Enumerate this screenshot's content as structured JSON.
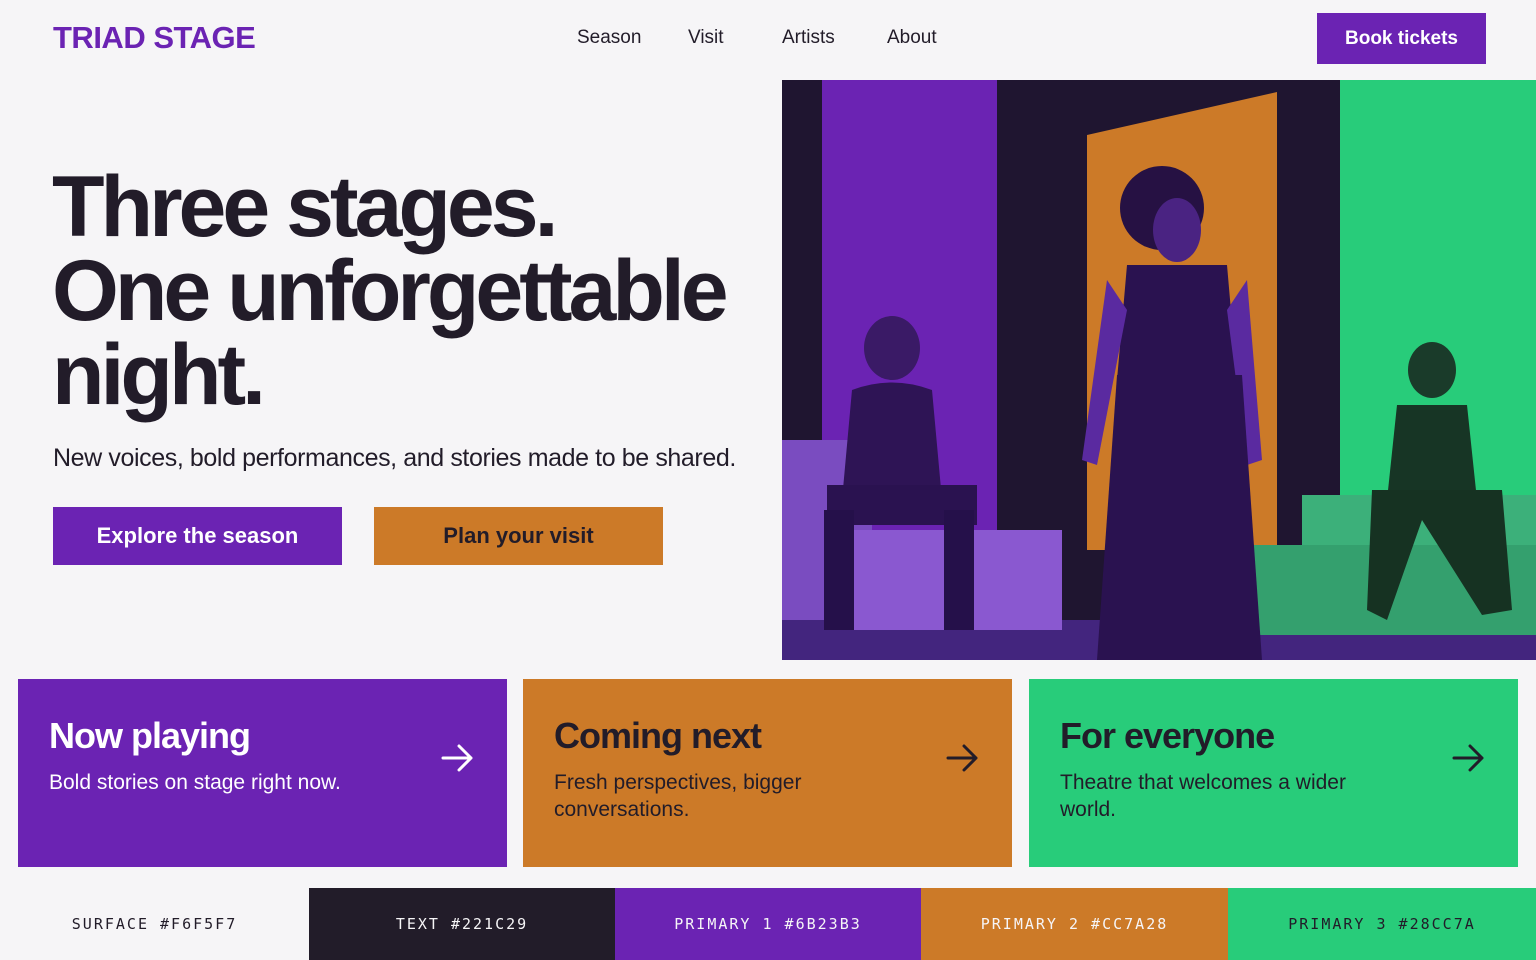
{
  "header": {
    "logo": "TRIAD STAGE",
    "nav": [
      {
        "label": "Season"
      },
      {
        "label": "Visit"
      },
      {
        "label": "Artists"
      },
      {
        "label": "About"
      }
    ],
    "book_label": "Book tickets"
  },
  "hero": {
    "headline_lines": [
      "Three stages.",
      "One unforgettable",
      "night."
    ],
    "subhead": "New voices, bold performances, and stories made to be shared.",
    "cta_primary": "Explore the season",
    "cta_secondary": "Plan your visit",
    "image": "stage-performers-photo"
  },
  "cards": [
    {
      "title": "Now playing",
      "desc": "Bold stories on stage right now.",
      "icon": "arrow-right-icon"
    },
    {
      "title": "Coming next",
      "desc": "Fresh perspectives, bigger conversations.",
      "icon": "arrow-right-icon"
    },
    {
      "title": "For everyone",
      "desc": "Theatre that welcomes a wider world.",
      "icon": "arrow-right-icon"
    }
  ],
  "palette": [
    {
      "label": "SURFACE #F6F5F7",
      "color": "#F6F5F7"
    },
    {
      "label": "TEXT #221C29",
      "color": "#221C29"
    },
    {
      "label": "PRIMARY 1 #6B23B3",
      "color": "#6B23B3"
    },
    {
      "label": "PRIMARY 2 #CC7A28",
      "color": "#CC7A28"
    },
    {
      "label": "PRIMARY 3 #28CC7A",
      "color": "#28CC7A"
    }
  ],
  "colors": {
    "surface": "#F6F5F7",
    "text": "#221C29",
    "primary1": "#6B23B3",
    "primary2": "#CC7A28",
    "primary3": "#28CC7A"
  }
}
